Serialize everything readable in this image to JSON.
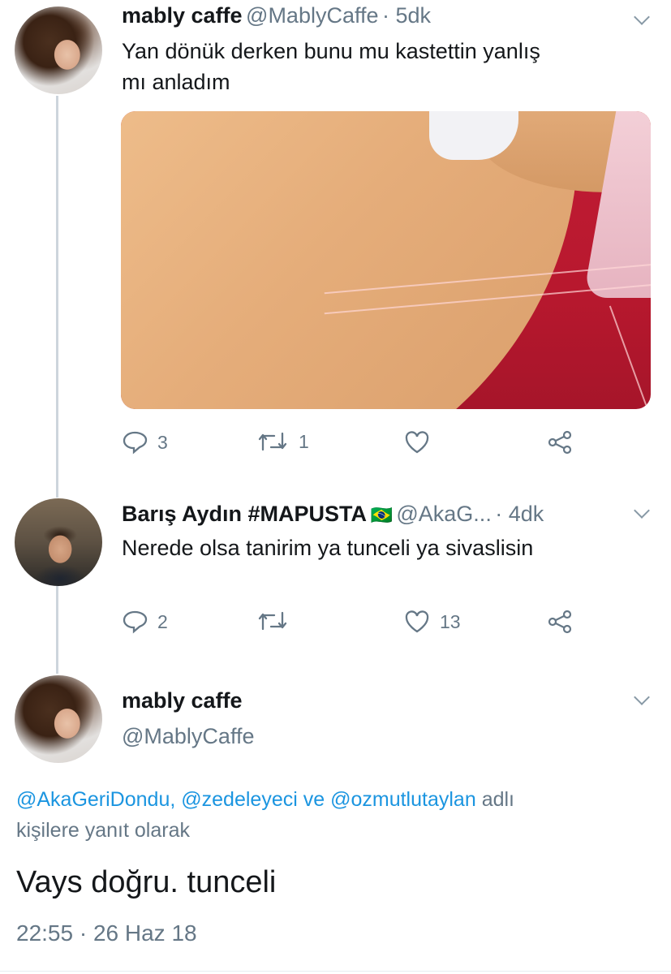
{
  "tweets": [
    {
      "name": "mably caffe",
      "handle": "@MablyCaffe",
      "time": "· 5dk",
      "text_line1": "Yan dönük derken bunu mu kastettin yanlış",
      "text_line2": "mı anladım",
      "reply_count": "3",
      "retweet_count": "1",
      "like_count": ""
    },
    {
      "name": "Barış Aydın #MAPUSTA",
      "flag": "🇧🇷",
      "handle": "@AkaG...",
      "time": "· 4dk",
      "text": "Nerede olsa tanirim ya tunceli ya sivaslisin",
      "reply_count": "2",
      "retweet_count": "",
      "like_count": "13"
    }
  ],
  "main_tweet": {
    "name": "mably caffe",
    "handle": "@MablyCaffe",
    "reply_to": {
      "mention1": "@AkaGeriDondu,",
      "mention2": "@zedeleyeci",
      "connector": "ve",
      "mention3": "@ozmutlutaylan",
      "suffix1": "adlı",
      "suffix2": "kişilere yanıt olarak"
    },
    "text": "Vays doğru. tunceli",
    "timestamp": "22:55 · 26 Haz 18"
  },
  "icons": {
    "reply": "reply-icon",
    "retweet": "retweet-icon",
    "like": "heart-icon",
    "share": "share-icon",
    "menu": "chevron-down-icon"
  },
  "colors": {
    "link": "#1b95e0",
    "muted": "#657786",
    "text": "#14171a"
  }
}
